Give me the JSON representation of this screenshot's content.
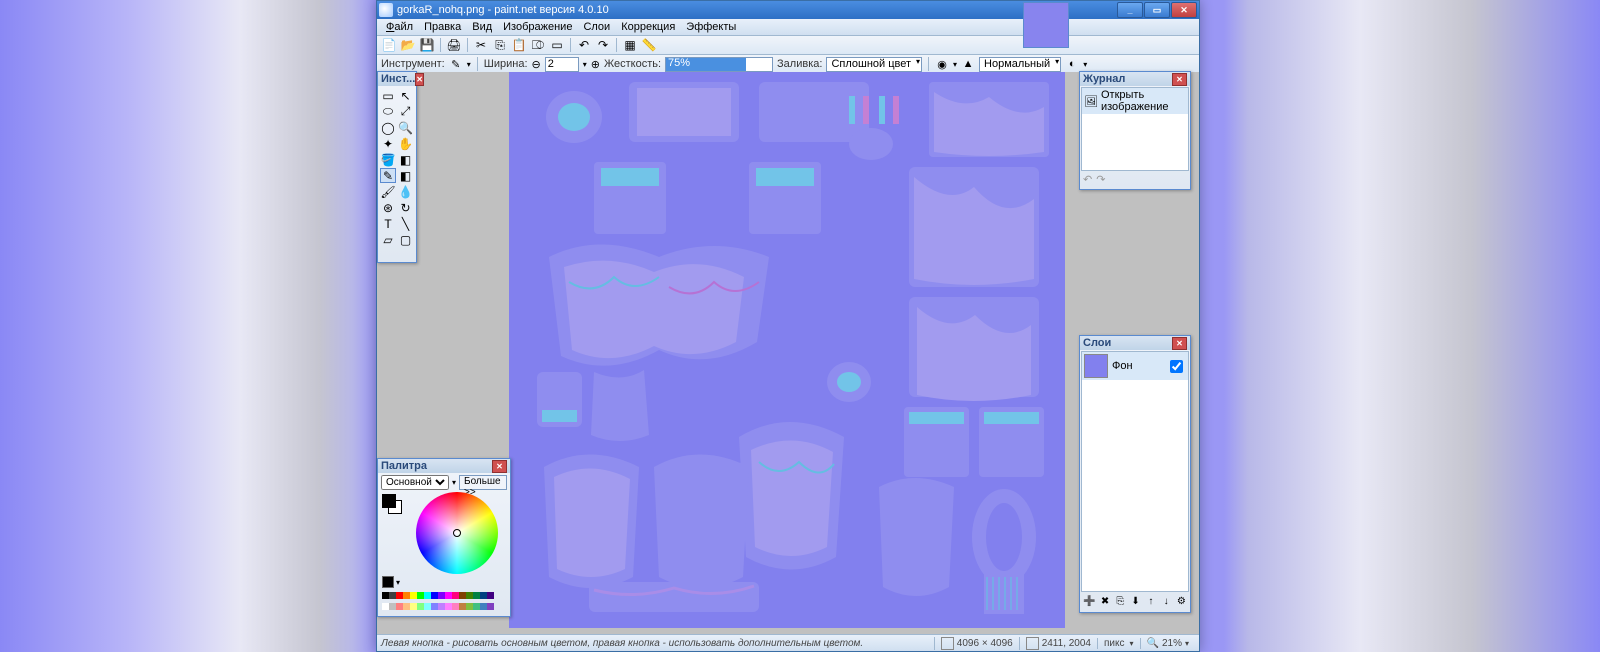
{
  "titlebar": {
    "title": "gorkaR_nohq.png - paint.net версия 4.0.10"
  },
  "window_buttons": {
    "min": "_",
    "max": "▭",
    "close": "✕"
  },
  "menu": {
    "file": "Файл",
    "edit": "Правка",
    "view": "Вид",
    "image": "Изображение",
    "layers": "Слои",
    "adjust": "Коррекция",
    "effects": "Эффекты"
  },
  "options": {
    "tool_label": "Инструмент:",
    "width_label": "Ширина:",
    "width_value": "2",
    "hardness_label": "Жесткость:",
    "hardness_value": "75%",
    "fill_label": "Заливка:",
    "fill_value": "Сплошной цвет",
    "blend_value": "Нормальный"
  },
  "tools_panel": {
    "title": "Инст..."
  },
  "history_panel": {
    "title": "Журнал",
    "open_image": "Открыть изображение"
  },
  "layers_panel": {
    "title": "Слои",
    "bg": "Фон"
  },
  "colors_panel": {
    "title": "Палитра",
    "primary": "Основной",
    "more": "Больше >>"
  },
  "status": {
    "hint": "Левая кнопка - рисовать основным цветом, правая кнопка - использовать дополнительным цветом.",
    "dims": "4096 × 4096",
    "coord": "2411, 2004",
    "unit": "пикс",
    "zoom": "21%"
  },
  "swatch_colors": [
    [
      "#000",
      "#404040",
      "#ff0000",
      "#ff8000",
      "#ffff00",
      "#00ff00",
      "#00ffff",
      "#0000ff",
      "#8000ff",
      "#ff00ff",
      "#ff0080",
      "#804000",
      "#408000",
      "#008040",
      "#004080",
      "#400080"
    ],
    [
      "#fff",
      "#c0c0c0",
      "#ff8080",
      "#ffc080",
      "#ffff80",
      "#80ff80",
      "#80ffff",
      "#8080ff",
      "#c080ff",
      "#ff80ff",
      "#ff80c0",
      "#c08040",
      "#80c040",
      "#40c080",
      "#4080c0",
      "#8040c0"
    ]
  ]
}
